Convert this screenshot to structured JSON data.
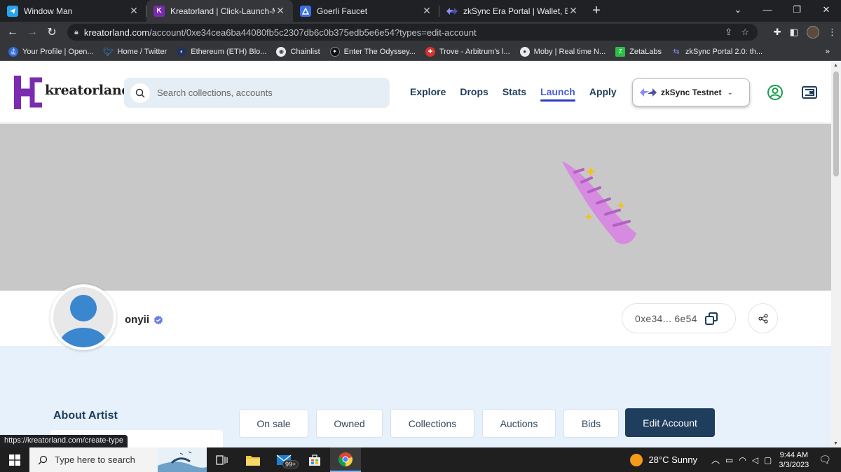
{
  "browser": {
    "tabs": [
      {
        "title": "Window Man",
        "favicon_color": "#2aa3ef",
        "favicon": "telegram-icon",
        "active": false
      },
      {
        "title": "Kreatorland | Click-Launch-Mint I",
        "favicon_color": "#7a2bb0",
        "favicon": "kreatorland-icon",
        "active": true
      },
      {
        "title": "Goerli Faucet",
        "favicon_color": "#3b6fe8",
        "favicon": "alchemy-icon",
        "active": false
      },
      {
        "title": "zkSync Era Portal | Wallet, Bridge",
        "favicon_color": "#8c8dfc",
        "favicon": "zksync-icon",
        "active": false
      }
    ],
    "url_host": "kreatorland.com",
    "url_path": "/account/0xe34cea6ba44080fb5c2307db6c0b375edb5e6e54?types=edit-account",
    "bookmarks": [
      {
        "label": "Your Profile | Open...",
        "color": "#2d6ad6"
      },
      {
        "label": "Home / Twitter",
        "color": "#1d9bf0"
      },
      {
        "label": "Ethereum (ETH) Blo...",
        "color": "#21325b"
      },
      {
        "label": "Chainlist",
        "color": "#444"
      },
      {
        "label": "Enter The Odyssey...",
        "color": "#222"
      },
      {
        "label": "Trove - Arbitrum's l...",
        "color": "#d9312b"
      },
      {
        "label": "Moby | Real time N...",
        "color": "#555"
      },
      {
        "label": "ZetaLabs",
        "color": "#2bbf4a"
      },
      {
        "label": "zkSync Portal 2.0: th...",
        "color": "#8c8dfc"
      }
    ],
    "status_url": "https://kreatorland.com/create-type"
  },
  "site": {
    "logo_text": "kreatorland",
    "search_placeholder": "Search collections, accounts",
    "nav": [
      {
        "label": "Explore",
        "active": false
      },
      {
        "label": "Drops",
        "active": false
      },
      {
        "label": "Stats",
        "active": false
      },
      {
        "label": "Launch",
        "active": true
      },
      {
        "label": "Apply",
        "active": false
      }
    ],
    "network": "zkSync Testnet"
  },
  "profile": {
    "username": "onyii",
    "address_short": "0xe34... 6e54",
    "about_title": "About Artist",
    "filters": [
      {
        "label": "On sale"
      },
      {
        "label": "Owned"
      },
      {
        "label": "Collections"
      },
      {
        "label": "Auctions"
      },
      {
        "label": "Bids"
      }
    ],
    "edit_label": "Edit Account"
  },
  "taskbar": {
    "search_text": "Type here to search",
    "weather": "28°C  Sunny",
    "time": "9:44 AM",
    "date": "3/3/2023",
    "mail_badge": "99+"
  },
  "colors": {
    "brand_purple": "#7a2bb0",
    "navy": "#1f3d5c",
    "active_nav": "#4a5fd6"
  }
}
